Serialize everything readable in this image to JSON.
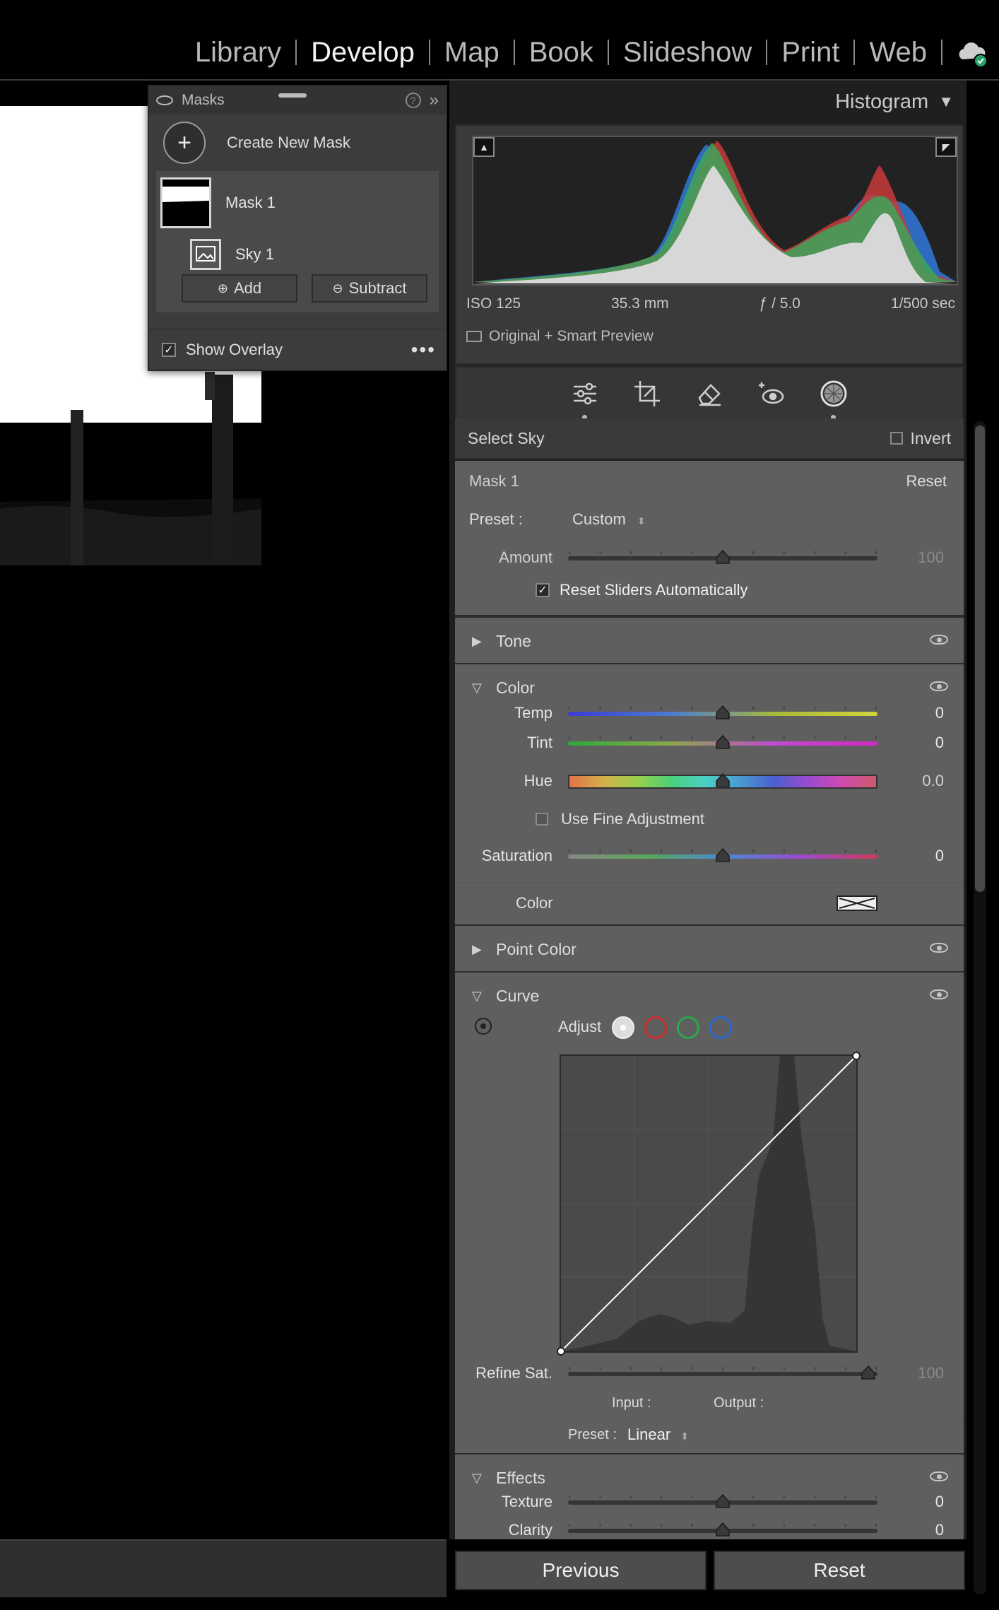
{
  "modules": [
    "Library",
    "Develop",
    "Map",
    "Book",
    "Slideshow",
    "Print",
    "Web"
  ],
  "active_module": "Develop",
  "masks_panel": {
    "title": "Masks",
    "create_label": "Create New Mask",
    "mask1": "Mask 1",
    "sky1": "Sky 1",
    "add": "Add",
    "subtract": "Subtract",
    "show_overlay": "Show Overlay",
    "show_overlay_checked": true
  },
  "histogram": {
    "title": "Histogram",
    "iso": "ISO 125",
    "focal": "35.3 mm",
    "aperture": "ƒ / 5.0",
    "shutter": "1/500 sec",
    "preview": "Original + Smart Preview"
  },
  "select_sky": {
    "label": "Select Sky",
    "invert": "Invert"
  },
  "mask_settings": {
    "title": "Mask 1",
    "reset": "Reset",
    "preset_label": "Preset :",
    "preset_value": "Custom",
    "amount_label": "Amount",
    "amount_value": "100",
    "amount_level": 0.5,
    "reset_sliders": "Reset Sliders Automatically",
    "reset_sliders_checked": true
  },
  "tone": {
    "title": "Tone"
  },
  "color_section": {
    "title": "Color",
    "temp": {
      "label": "Temp",
      "value": "0",
      "level": 0.5
    },
    "tint": {
      "label": "Tint",
      "value": "0",
      "level": 0.5
    },
    "hue": {
      "label": "Hue",
      "value": "0.0",
      "level": 0.5
    },
    "fine": "Use Fine Adjustment",
    "saturation": {
      "label": "Saturation",
      "value": "0",
      "level": 0.5
    },
    "color_label": "Color"
  },
  "point_color": {
    "title": "Point Color"
  },
  "curve": {
    "title": "Curve",
    "adjust": "Adjust",
    "refine_label": "Refine Sat.",
    "refine_value": "100",
    "refine_level": 0.97,
    "input": "Input :",
    "output": "Output :",
    "preset_label": "Preset :",
    "preset_value": "Linear"
  },
  "effects": {
    "title": "Effects",
    "texture": {
      "label": "Texture",
      "value": "0",
      "level": 0.5
    },
    "clarity": {
      "label": "Clarity",
      "value": "0",
      "level": 0.5
    }
  },
  "buttons": {
    "previous": "Previous",
    "reset": "Reset"
  }
}
